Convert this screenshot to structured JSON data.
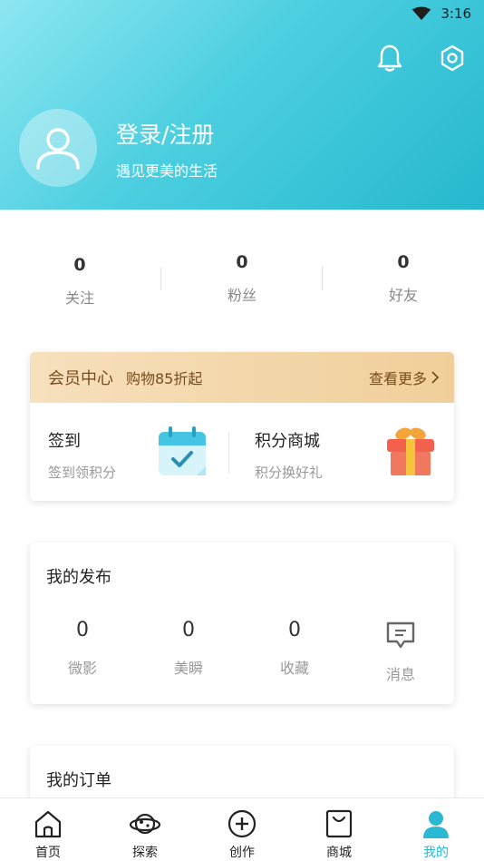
{
  "status_bar": {
    "time": "3:16"
  },
  "header": {
    "login_title": "登录/注册",
    "login_subtitle": "遇见更美的生活"
  },
  "stats": [
    {
      "value": "0",
      "label": "关注"
    },
    {
      "value": "0",
      "label": "粉丝"
    },
    {
      "value": "0",
      "label": "好友"
    }
  ],
  "member": {
    "title": "会员中心",
    "promo": "购物85折起",
    "more": "查看更多",
    "items": [
      {
        "title": "签到",
        "subtitle": "签到领积分",
        "icon": "calendar-check-icon"
      },
      {
        "title": "积分商城",
        "subtitle": "积分换好礼",
        "icon": "gift-icon"
      }
    ]
  },
  "publish": {
    "title": "我的发布",
    "items": [
      {
        "value": "0",
        "label": "微影"
      },
      {
        "value": "0",
        "label": "美瞬"
      },
      {
        "value": "0",
        "label": "收藏"
      }
    ],
    "message_label": "消息"
  },
  "orders": {
    "title": "我的订单"
  },
  "tabbar": [
    {
      "label": "首页",
      "icon": "home-icon"
    },
    {
      "label": "探索",
      "icon": "planet-icon"
    },
    {
      "label": "创作",
      "icon": "plus-circle-icon"
    },
    {
      "label": "商城",
      "icon": "shopping-bag-icon"
    },
    {
      "label": "我的",
      "icon": "user-icon",
      "active": true
    }
  ],
  "colors": {
    "accent": "#2bb8d3",
    "header_gradient_start": "#8de6f2",
    "header_gradient_end": "#26b8cf",
    "member_gold": "#f0cf9a"
  }
}
